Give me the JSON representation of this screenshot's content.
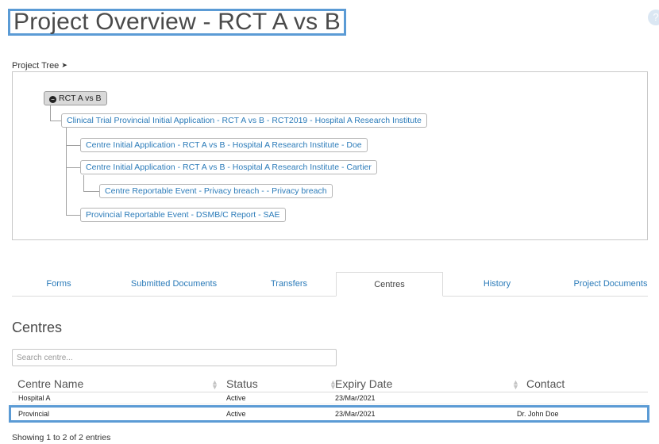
{
  "page": {
    "title": "Project Overview - RCT A vs B"
  },
  "project_tree": {
    "toggle_label": "Project Tree",
    "root": "RCT A vs B",
    "nodes": [
      "Clinical Trial Provincial Initial Application - RCT A vs B - RCT2019 - Hospital A Research Institute",
      "Centre Initial Application - RCT A vs B - Hospital A Research Institute - Doe",
      "Centre Initial Application - RCT A vs B - Hospital A Research Institute - Cartier",
      "Centre Reportable Event - Privacy breach - - Privacy breach",
      "Provincial Reportable Event - DSMB/C Report - SAE"
    ]
  },
  "tabs": [
    {
      "label": "Forms",
      "active": false
    },
    {
      "label": "Submitted Documents",
      "active": false
    },
    {
      "label": "Transfers",
      "active": false
    },
    {
      "label": "Centres",
      "active": true
    },
    {
      "label": "History",
      "active": false
    },
    {
      "label": "Project Documents",
      "active": false
    }
  ],
  "centres": {
    "heading": "Centres",
    "search_placeholder": "Search centre...",
    "columns": [
      "Centre Name",
      "Status",
      "Expiry Date",
      "Contact"
    ],
    "rows": [
      [
        "Hospital A",
        "Active",
        "23/Mar/2021",
        ""
      ],
      [
        "Provincial",
        "Active",
        "23/Mar/2021",
        "Dr. John Doe"
      ]
    ],
    "info": "Showing 1 to 2 of 2 entries"
  },
  "colors": {
    "accent": "#5b9bd5",
    "link": "#2b7bb9"
  },
  "icons": {
    "help": "question-circle-icon",
    "tree_toggle": "chevron-down-icon",
    "root_collapse": "minus-circle-icon",
    "sort": "sort-icon"
  }
}
